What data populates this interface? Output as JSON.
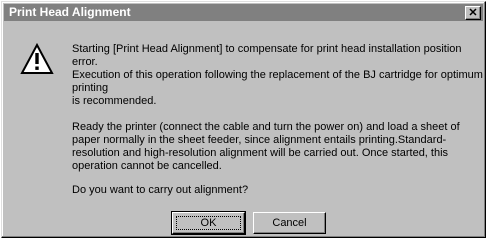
{
  "window": {
    "title": "Print Head Alignment",
    "close_glyph": "✕"
  },
  "message": {
    "icon": "warning-icon",
    "line1": "Starting [Print Head Alignment] to compensate for print head installation position error.",
    "line2": "Execution of this operation following the replacement of the BJ cartridge for optimum printing\nis recommended.",
    "line3": "Ready the printer (connect the cable and turn the power on) and load a sheet of paper normally in the sheet feeder, since alignment entails printing.Standard-resolution and high-resolution alignment will be carried out. Once started, this operation cannot be cancelled.",
    "line4": "Do you want to carry out alignment?"
  },
  "buttons": {
    "ok_label": "OK",
    "cancel_label": "Cancel"
  }
}
